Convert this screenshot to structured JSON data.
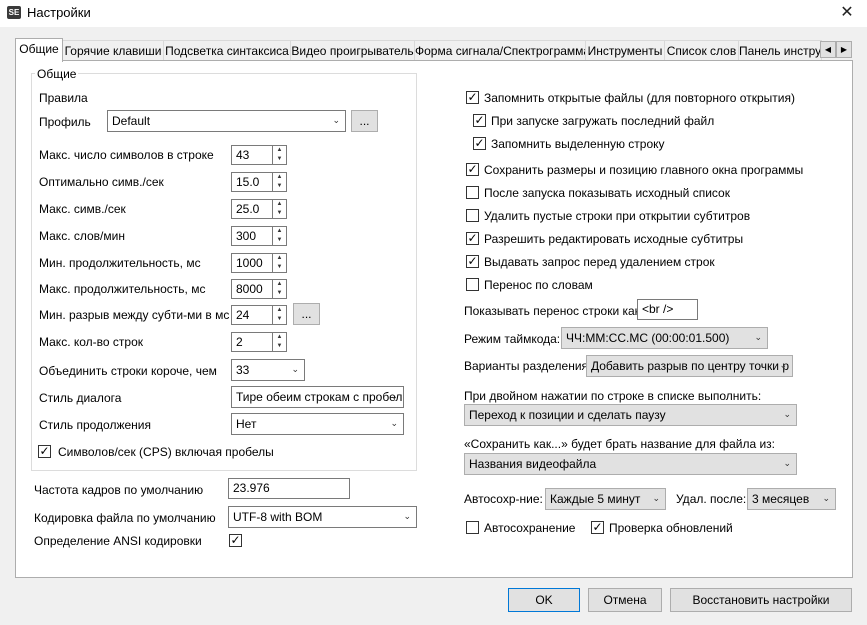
{
  "window": {
    "title": "Настройки",
    "app_icon_text": "SE",
    "close_glyph": "✕"
  },
  "tabs": [
    {
      "label": "Общие"
    },
    {
      "label": "Горячие клавиши"
    },
    {
      "label": "Подсветка синтаксиса"
    },
    {
      "label": "Видео проигрыватель"
    },
    {
      "label": "Форма сигнала/Спектрограмма"
    },
    {
      "label": "Инструменты"
    },
    {
      "label": "Список слов"
    },
    {
      "label": "Панель инстру"
    }
  ],
  "tab_scroll": {
    "left": "◀",
    "right": "▶"
  },
  "left": {
    "group_title": "Общие",
    "rules_label": "Правила",
    "profile_label": "Профиль",
    "profile_value": "Default",
    "profile_button": "...",
    "max_chars_label": "Макс. число символов в строке",
    "max_chars_value": "43",
    "optimal_cps_label": "Оптимально симв./сек",
    "optimal_cps_value": "15.0",
    "max_cps_label": "Макс. симв./сек",
    "max_cps_value": "25.0",
    "max_wpm_label": "Макс. слов/мин",
    "max_wpm_value": "300",
    "min_duration_label": "Мин. продолжительность, мс",
    "min_duration_value": "1000",
    "max_duration_label": "Макс. продолжительность, мс",
    "max_duration_value": "8000",
    "min_gap_label": "Мин. разрыв между субти-ми в мс",
    "min_gap_value": "24",
    "min_gap_button": "...",
    "max_lines_label": "Макс. кол-во строк",
    "max_lines_value": "2",
    "merge_label": "Объединить строки короче, чем",
    "merge_value": "33",
    "dialog_style_label": "Стиль диалога",
    "dialog_style_value": "Тире обеим строкам с пробел",
    "continuation_label": "Стиль продолжения",
    "continuation_value": "Нет",
    "cps_spaces_label": "Символов/сек (CPS) включая пробелы",
    "framerate_label": "Частота кадров по умолчанию",
    "framerate_value": "23.976",
    "encoding_label": "Кодировка файла по умолчанию",
    "encoding_value": "UTF-8 with BOM",
    "ansi_label": "Определение ANSI кодировки"
  },
  "right": {
    "remember_files": "Запомнить открытые файлы (для повторного открытия)",
    "load_last_file": "При запуске загружать последний файл",
    "remember_line": "Запомнить выделенную строку",
    "save_window_pos": "Сохранить размеры и позицию главного окна программы",
    "show_source_list": "После запуска показывать исходный список",
    "remove_empty": "Удалить пустые строки при открытии субтитров",
    "allow_edit_source": "Разрешить редактировать исходные субтитры",
    "confirm_delete": "Выдавать запрос перед удалением строк",
    "word_wrap": "Перенос по словам",
    "line_break_label": "Показывать перенос строки как:",
    "line_break_value": "<br />",
    "timecode_label": "Режим таймкода:",
    "timecode_value": "ЧЧ:ММ:СС.МС (00:00:01.500)",
    "split_label": "Варианты разделения",
    "split_value": "Добавить разрыв по центру точки р",
    "double_click_label": "При двойном нажатии по строке в списке выполнить:",
    "double_click_value": "Переход к позиции и сделать паузу",
    "save_as_label": "«Сохранить как...» будет брать название для файла из:",
    "save_as_value": "Названия видеофайла",
    "autosave_label": "Автосохр-ние:",
    "autosave_value": "Каждые 5 минут",
    "delete_after_label": "Удал. после:",
    "delete_after_value": "3 месяцев",
    "autosave_check": "Автосохранение",
    "check_updates": "Проверка обновлений"
  },
  "checks": {
    "cps_spaces": true,
    "ansi": true,
    "remember_files": true,
    "load_last_file": true,
    "remember_line": true,
    "save_window_pos": true,
    "show_source_list": false,
    "remove_empty": false,
    "allow_edit_source": true,
    "confirm_delete": true,
    "word_wrap": false,
    "autosave": false,
    "check_updates": true
  },
  "buttons": {
    "ok": "OK",
    "cancel": "Отмена",
    "restore": "Восстановить настройки"
  },
  "glyphs": {
    "check": "✓",
    "dropdown": "⌄",
    "spin_up": "▲",
    "spin_down": "▼"
  },
  "colors": {
    "accent": "#0078d7",
    "panel": "#ffffff",
    "background": "#f0f0f0"
  }
}
